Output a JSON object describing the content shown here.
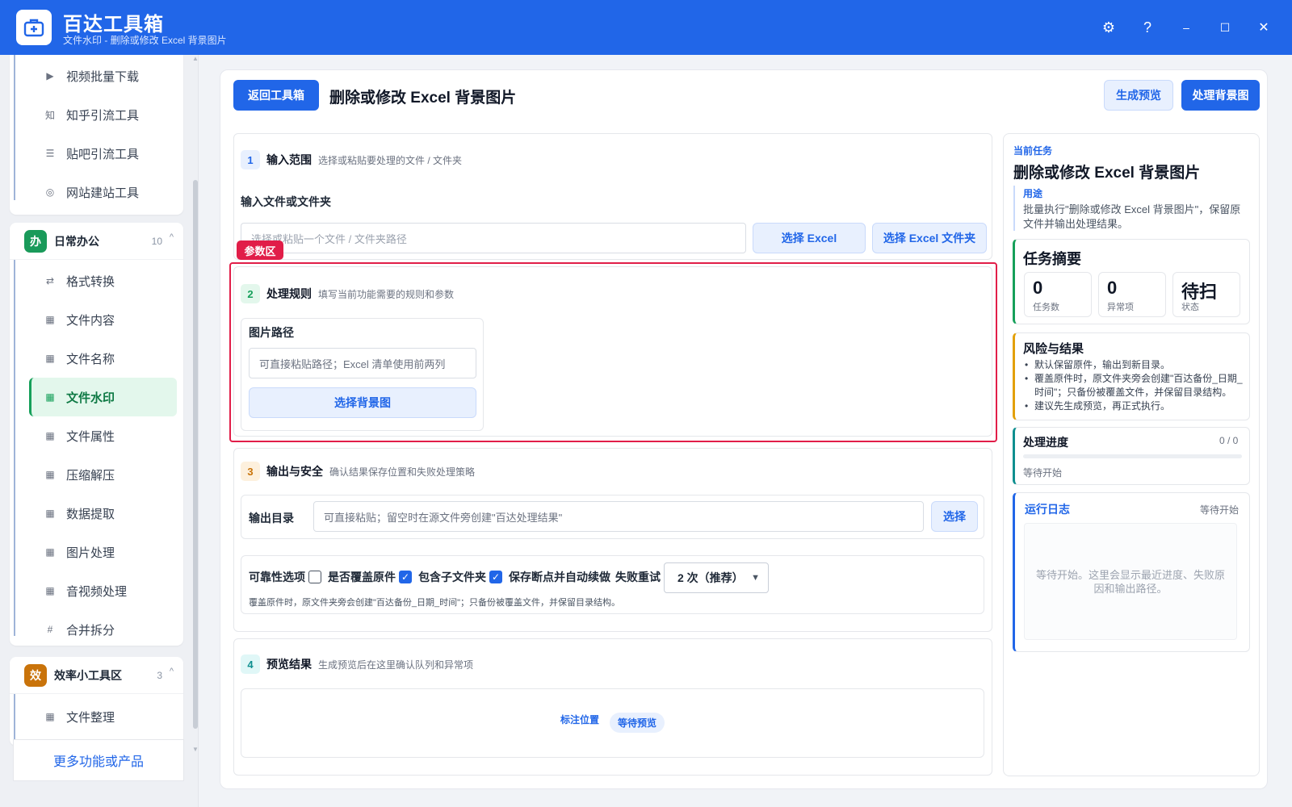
{
  "app": {
    "title": "百达工具箱",
    "subtitle": "文件水印 - 删除或修改 Excel 背景图片",
    "logo_icon": "toolbox-plus-icon"
  },
  "window_controls": {
    "settings": "⚙",
    "help": "?",
    "minimize": "–",
    "maximize": "☐",
    "close": "✕"
  },
  "sidebar": {
    "top_items": [
      {
        "label": "视频批量下载",
        "icon": "▶"
      },
      {
        "label": "知乎引流工具",
        "icon": "知"
      },
      {
        "label": "贴吧引流工具",
        "icon": "☰"
      },
      {
        "label": "网站建站工具",
        "icon": "◎"
      }
    ],
    "daily_office": {
      "badge": "办",
      "title": "日常办公",
      "count": "10",
      "items": [
        {
          "label": "格式转换",
          "icon": "⇄"
        },
        {
          "label": "文件内容",
          "icon": "▦"
        },
        {
          "label": "文件名称",
          "icon": "▦"
        },
        {
          "label": "文件水印",
          "icon": "▦",
          "active": true
        },
        {
          "label": "文件属性",
          "icon": "▦"
        },
        {
          "label": "压缩解压",
          "icon": "▦"
        },
        {
          "label": "数据提取",
          "icon": "▦"
        },
        {
          "label": "图片处理",
          "icon": "▦"
        },
        {
          "label": "音视频处理",
          "icon": "▦"
        },
        {
          "label": "合并拆分",
          "icon": "#"
        }
      ]
    },
    "efficiency": {
      "badge": "效",
      "title": "效率小工具区",
      "count": "3",
      "items": [
        {
          "label": "文件整理",
          "icon": "▦"
        }
      ]
    },
    "more_label": "更多功能或产品"
  },
  "header": {
    "back_label": "返回工具箱",
    "page_title": "删除或修改 Excel 背景图片",
    "preview_label": "生成预览",
    "process_label": "处理背景图"
  },
  "section1": {
    "num": "1",
    "title": "输入范围",
    "desc": "选择或粘贴要处理的文件 / 文件夹",
    "field_label": "输入文件或文件夹",
    "placeholder": "选择或粘贴一个文件 / 文件夹路径",
    "btn_excel": "选择 Excel",
    "btn_folder": "选择 Excel 文件夹"
  },
  "highlight_tag": "参数区",
  "section2": {
    "num": "2",
    "title": "处理规则",
    "desc": "填写当前功能需要的规则和参数",
    "image_path_label": "图片路径",
    "image_path_placeholder": "可直接粘贴路径；Excel 清单使用前两列",
    "choose_bg_label": "选择背景图"
  },
  "section3": {
    "num": "3",
    "title": "输出与安全",
    "desc": "确认结果保存位置和失败处理策略",
    "output_label": "输出目录",
    "output_placeholder": "可直接粘贴；留空时在源文件旁创建\"百达处理结果\"",
    "choose_label": "选择",
    "reliability_label": "可靠性选项",
    "opt_overwrite": "是否覆盖原件",
    "opt_overwrite_checked": false,
    "opt_subfolders": "包含子文件夹",
    "opt_subfolders_checked": true,
    "opt_resume": "保存断点并自动续做",
    "opt_resume_checked": true,
    "retry_label": "失败重试",
    "retry_value": "2 次（推荐）",
    "note": "覆盖原件时，原文件夹旁会创建\"百达备份_日期_时间\"；只备份被覆盖文件，并保留目录结构。"
  },
  "section4": {
    "num": "4",
    "title": "预览结果",
    "desc": "生成预览后在这里确认队列和异常项",
    "mark_label": "标注位置",
    "status_badge": "等待预览"
  },
  "right": {
    "current_task_label": "当前任务",
    "task_title": "删除或修改 Excel 背景图片",
    "purpose_label": "用途",
    "purpose_text": "批量执行\"删除或修改 Excel 背景图片\"，保留原文件并输出处理结果。",
    "summary_title": "任务摘要",
    "stats": [
      {
        "value": "0",
        "label": "任务数"
      },
      {
        "value": "0",
        "label": "异常项"
      },
      {
        "value": "待扫",
        "label": "状态"
      }
    ],
    "risk_title": "风险与结果",
    "risk_items": [
      "默认保留原件，输出到新目录。",
      "覆盖原件时，原文件夹旁会创建\"百达备份_日期_时间\"；只备份被覆盖文件，并保留目录结构。",
      "建议先生成预览，再正式执行。"
    ],
    "progress_title": "处理进度",
    "progress_value": "0 / 0",
    "progress_fraction": 0,
    "progress_status": "等待开始",
    "log_title": "运行日志",
    "log_status": "等待开始",
    "log_placeholder": "等待开始。这里会显示最近进度、失败原因和输出路径。"
  },
  "colors": {
    "brand": "#2166e8",
    "active_green": "#16a05a",
    "highlight_red": "#e11d48"
  }
}
